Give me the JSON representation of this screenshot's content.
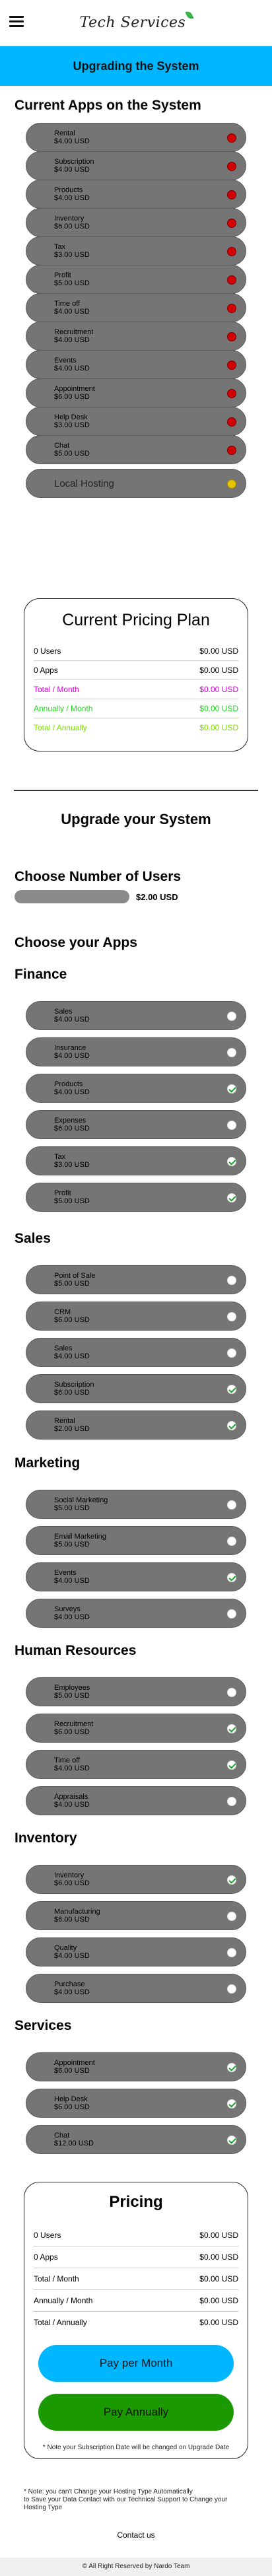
{
  "header": {
    "logo": "Tech Services"
  },
  "banner": "Upgrading the System",
  "current": {
    "title": "Current Apps on the System",
    "apps": [
      {
        "name": "Rental",
        "price": "$4.00 USD"
      },
      {
        "name": "Subscription",
        "price": "$4.00 USD"
      },
      {
        "name": "Products",
        "price": "$4.00 USD"
      },
      {
        "name": "Inventory",
        "price": "$6.00 USD"
      },
      {
        "name": "Tax",
        "price": "$3.00 USD"
      },
      {
        "name": "Profit",
        "price": "$5.00 USD"
      },
      {
        "name": "Time off",
        "price": "$4.00 USD"
      },
      {
        "name": "Recruitment",
        "price": "$4.00 USD"
      },
      {
        "name": "Events",
        "price": "$4.00 USD"
      },
      {
        "name": "Appointment",
        "price": "$6.00 USD"
      },
      {
        "name": "Help Desk",
        "price": "$3.00 USD"
      },
      {
        "name": "Chat",
        "price": "$5.00 USD"
      }
    ],
    "local": "Local Hosting"
  },
  "current_plan": {
    "title": "Current Pricing Plan",
    "rows": [
      {
        "label": "0 Users",
        "value": "$0.00 USD"
      },
      {
        "label": "0 Apps",
        "value": "$0.00 USD"
      },
      {
        "label": "Total / Month",
        "value": "$0.00 USD"
      },
      {
        "label": "Annually / Month",
        "value": "$0.00 USD"
      },
      {
        "label": "Total / Annually",
        "value": "$0.00 USD"
      }
    ]
  },
  "upgrade_title": "Upgrade your System",
  "users": {
    "title": "Choose Number of Users",
    "value": "$2.00 USD"
  },
  "choose_title": "Choose your Apps",
  "groups": [
    {
      "title": "Finance",
      "apps": [
        {
          "name": "Sales",
          "price": "$4.00 USD",
          "on": false
        },
        {
          "name": "Insurance",
          "price": "$4.00 USD",
          "on": false
        },
        {
          "name": "Products",
          "price": "$4.00 USD",
          "on": true
        },
        {
          "name": "Expenses",
          "price": "$6.00 USD",
          "on": false
        },
        {
          "name": "Tax",
          "price": "$3.00 USD",
          "on": true
        },
        {
          "name": "Profit",
          "price": "$5.00 USD",
          "on": true
        }
      ]
    },
    {
      "title": "Sales",
      "apps": [
        {
          "name": "Point of Sale",
          "price": "$5.00 USD",
          "on": false
        },
        {
          "name": "CRM",
          "price": "$6.00 USD",
          "on": false
        },
        {
          "name": "Sales",
          "price": "$4.00 USD",
          "on": false
        },
        {
          "name": "Subscription",
          "price": "$6.00 USD",
          "on": true
        },
        {
          "name": "Rental",
          "price": "$2.00 USD",
          "on": true
        }
      ]
    },
    {
      "title": "Marketing",
      "apps": [
        {
          "name": "Social Marketing",
          "price": "$5.00 USD",
          "on": false
        },
        {
          "name": "Email Marketing",
          "price": "$5.00 USD",
          "on": false
        },
        {
          "name": "Events",
          "price": "$4.00 USD",
          "on": true
        },
        {
          "name": "Surveys",
          "price": "$4.00 USD",
          "on": false
        }
      ]
    },
    {
      "title": "Human Resources",
      "apps": [
        {
          "name": "Employees",
          "price": "$5.00 USD",
          "on": false
        },
        {
          "name": "Recruitment",
          "price": "$6.00 USD",
          "on": true
        },
        {
          "name": "Time off",
          "price": "$4.00 USD",
          "on": true
        },
        {
          "name": "Appraisals",
          "price": "$4.00 USD",
          "on": false
        }
      ]
    },
    {
      "title": "Inventory",
      "apps": [
        {
          "name": "Inventory",
          "price": "$6.00 USD",
          "on": true
        },
        {
          "name": "Manufacturing",
          "price": "$6.00 USD",
          "on": false
        },
        {
          "name": "Quality",
          "price": "$4.00 USD",
          "on": false
        },
        {
          "name": "Purchase",
          "price": "$4.00 USD",
          "on": false
        }
      ]
    },
    {
      "title": "Services",
      "apps": [
        {
          "name": "Appointment",
          "price": "$6.00 USD",
          "on": true
        },
        {
          "name": "Help Desk",
          "price": "$6.00 USD",
          "on": true
        },
        {
          "name": "Chat",
          "price": "$12.00 USD",
          "on": true
        }
      ]
    }
  ],
  "pricing": {
    "title": "Pricing",
    "rows": [
      {
        "label": "0 Users",
        "value": "$0.00 USD"
      },
      {
        "label": "0 Apps",
        "value": "$0.00 USD"
      },
      {
        "label": "Total / Month",
        "value": "$0.00 USD"
      },
      {
        "label": "Annually / Month",
        "value": "$0.00 USD"
      },
      {
        "label": "Total / Annually",
        "value": "$0.00 USD"
      }
    ],
    "pay_month": "Pay per Month",
    "pay_year": "Pay Annually",
    "note": "* Note your Subscription Date will be changed on Upgrade Date"
  },
  "footnote": {
    "line1": "* Note: you can't Change your Hosting Type Automatically",
    "line2": "to Save your Data Contact with our Technical Support to Change your Hosting Type"
  },
  "contact": "Contact us",
  "copyright": "© All Right Reserved by Nardo Team",
  "colors": {
    "accent": "#00b6ff",
    "green": "#1a9a00",
    "pill": "#757575"
  }
}
